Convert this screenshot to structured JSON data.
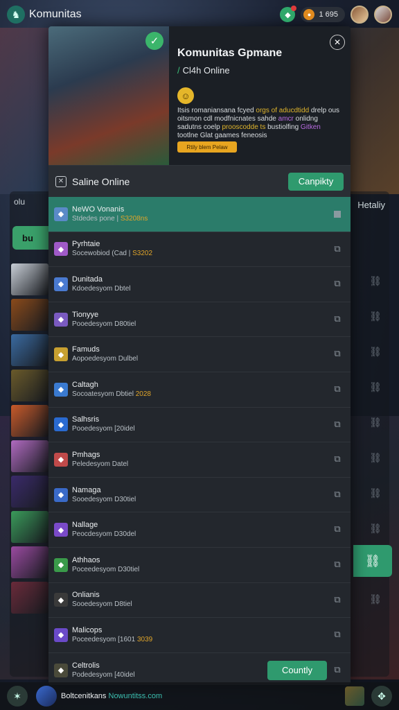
{
  "topbar": {
    "title": "Komunitas",
    "gem_icon": "gem-icon",
    "coins": "1 695"
  },
  "background": {
    "left_label": "olu",
    "left_button": "bu",
    "right_label": "Hetaliy",
    "thumb_colors": [
      "#c8ced6",
      "#8a4a1a",
      "#3a6aa0",
      "#6a5a2a",
      "#c85a2a",
      "#b06ac0",
      "#3a2a6a",
      "#3a9a5a",
      "#9a4aa0",
      "#6a2a3a"
    ]
  },
  "modal": {
    "hero": {
      "title": "Komunitas Gpmane",
      "online": "Cl4h Online",
      "desc_1": "Itsis romaniansana fcyed",
      "desc_hl": "orgs of aducdtidd",
      "desc_2": "drelp ous oitsmon cdl modfnicnates sahde",
      "desc_hl2": "amcr",
      "desc_3": "onlidng sadutns coelp",
      "desc_hl3": "prooscodde ts",
      "desc_4": "bustiolfing",
      "desc_hl4": "Gitken",
      "desc_5": "tootlne Glat gaames feneosis",
      "button": "Rtily blem Pelaw"
    },
    "section": {
      "title": "Saline Online",
      "button": "Canpikty"
    },
    "rows": [
      {
        "name": "NeWO Vonanis",
        "sub": "Stdedes pone |",
        "val": "S3208ns",
        "color": "#5a8ac8"
      },
      {
        "name": "Pyrhtaie",
        "sub": "Socewobiod (Cad |",
        "val": "S3202",
        "color": "#a05ac8"
      },
      {
        "name": "Dunitada",
        "sub": "Kdoedesyom Dbtel",
        "val": "",
        "color": "#4a7ad0"
      },
      {
        "name": "Tionyye",
        "sub": "Pooedesyom D80tiel",
        "val": "",
        "color": "#7a5ac0"
      },
      {
        "name": "Famuds",
        "sub": "Aopoedesyom Dulbel",
        "val": "",
        "color": "#c8a030"
      },
      {
        "name": "Caltagh",
        "sub": "Socoatesyom Dbtiel",
        "val": "2028",
        "color": "#3a7ad0"
      },
      {
        "name": "Salhsris",
        "sub": "Pooedesyom [20idel",
        "val": "",
        "color": "#2a6ad0"
      },
      {
        "name": "Pmhags",
        "sub": "Peledesyom Datel",
        "val": "",
        "color": "#c04a4a"
      },
      {
        "name": "Namaga",
        "sub": "Sooedesyom D30tiel",
        "val": "",
        "color": "#3a6ac8"
      },
      {
        "name": "Nallage",
        "sub": "Peocdesyom D30del",
        "val": "",
        "color": "#7a4ac8"
      },
      {
        "name": "Athhaos",
        "sub": "Poceedesyom D30tiel",
        "val": "",
        "color": "#3a9a4a"
      },
      {
        "name": "Onlianis",
        "sub": "Sooedesyom D8tiel",
        "val": "",
        "color": "#3a3a3a"
      },
      {
        "name": "Malicops",
        "sub": "Poceedesyom [1601",
        "val": "3039",
        "color": "#6a4ac8"
      },
      {
        "name": "Celtrolis",
        "sub": "Podedesyom [40idel",
        "val": "",
        "color": "#4a4a3a"
      }
    ],
    "row_button": "Countly"
  },
  "bottombar": {
    "label": "Boltcenitkans",
    "label_alt": "Nowuntitss.com"
  }
}
